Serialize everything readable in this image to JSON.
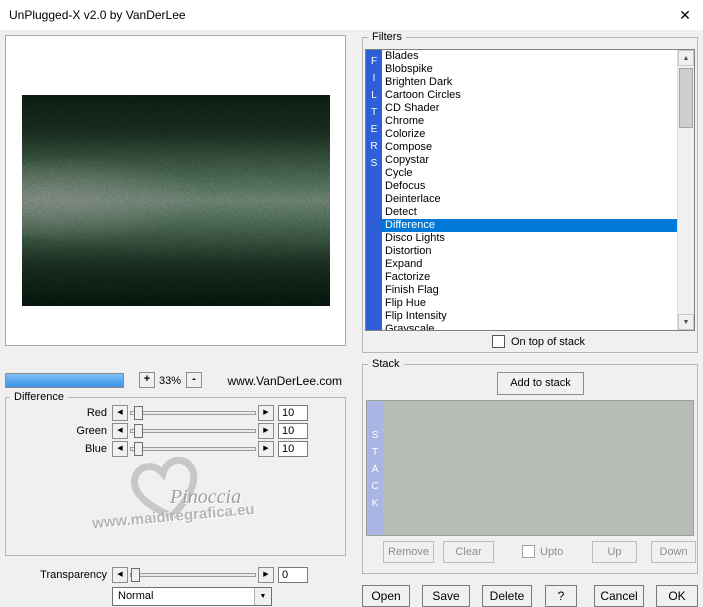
{
  "window": {
    "title": "UnPlugged-X v2.0 by VanDerLee"
  },
  "icons": {
    "close": "✕",
    "spin_left": "◀",
    "spin_right": "▶",
    "scroll_up": "▲",
    "scroll_down": "▼",
    "dropdown_arrow": "▼"
  },
  "preview": {
    "zoom_in_label": "+",
    "zoom_level": "33%",
    "zoom_out_label": "-",
    "website": "www.VanDerLee.com"
  },
  "settings": {
    "group_label": "Difference",
    "sliders": [
      {
        "label": "Red",
        "value": "10"
      },
      {
        "label": "Green",
        "value": "10"
      },
      {
        "label": "Blue",
        "value": "10"
      }
    ],
    "transparency_label": "Transparency",
    "transparency_value": "0",
    "blend_mode": "Normal",
    "watermark_name": "Pinoccia",
    "watermark_site": "www.maidiregrafica.eu"
  },
  "filters": {
    "group_label": "Filters",
    "vertical_label": "F\nI\nL\nT\nE\nR\nS",
    "selected": "Difference",
    "items": [
      "Blades",
      "Blobspike",
      "Brighten Dark",
      "Cartoon Circles",
      "CD Shader",
      "Chrome",
      "Colorize",
      "Compose",
      "Copystar",
      "Cycle",
      "Defocus",
      "Deinterlace",
      "Detect",
      "Difference",
      "Disco Lights",
      "Distortion",
      "Expand",
      "Factorize",
      "Finish Flag",
      "Flip Hue",
      "Flip Intensity",
      "Grayscale"
    ],
    "on_top_label": "On top of stack"
  },
  "stack": {
    "group_label": "Stack",
    "vertical_label": "S\nT\nA\nC\nK",
    "add_button": "Add to stack",
    "remove_button": "Remove",
    "clear_button": "Clear",
    "upto_label": "Upto",
    "up_button": "Up",
    "down_button": "Down"
  },
  "footer": {
    "open": "Open",
    "save": "Save",
    "delete": "Delete",
    "help": "?",
    "cancel": "Cancel",
    "ok": "OK"
  },
  "colors": {
    "selection_blue": "#0078d7",
    "filters_bar_blue": "#2e5fd8",
    "stack_bar_periwinkle": "#a9b5e2",
    "stack_area_green": "#b5bdb5",
    "progress_blue": "#3a92ea",
    "background_gray": "#f0f0f0"
  }
}
